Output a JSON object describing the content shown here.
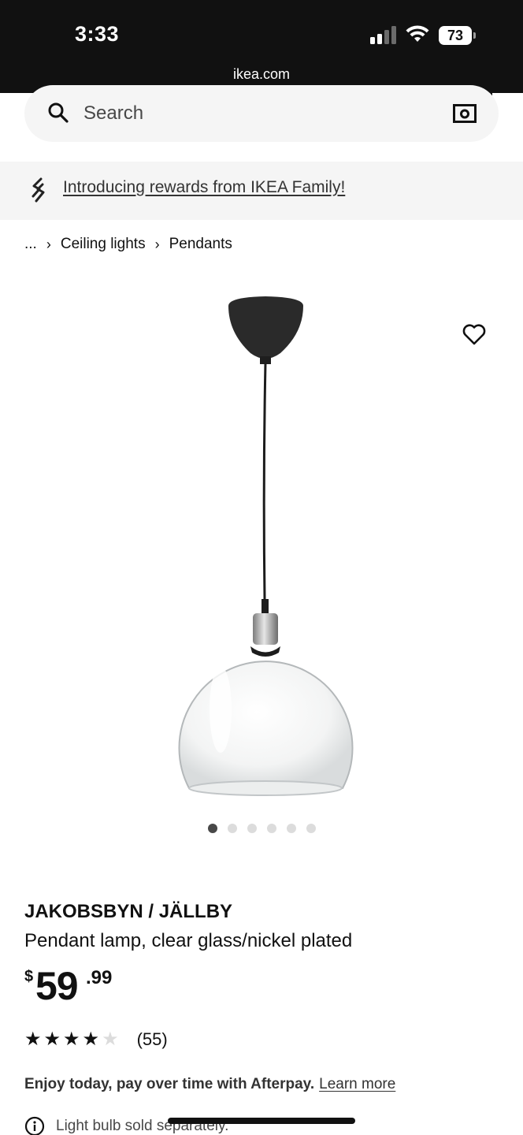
{
  "status_bar": {
    "time": "3:33",
    "battery": "73",
    "url": "ikea.com"
  },
  "search": {
    "placeholder": "Search"
  },
  "banner": {
    "text": "Introducing rewards from IKEA Family!"
  },
  "breadcrumb": {
    "ellipsis": "...",
    "items": [
      "Ceiling lights",
      "Pendants"
    ]
  },
  "carousel": {
    "total": 6,
    "active": 1
  },
  "product": {
    "name": "JAKOBSBYN / JÄLLBY",
    "description": "Pendant lamp, clear glass/nickel plated",
    "price_symbol": "$",
    "price_integer": "59",
    "price_decimal": ".99",
    "rating": 4,
    "rating_max": 5,
    "review_count": "(55)"
  },
  "afterpay": {
    "text": "Enjoy today, pay over time with Afterpay.",
    "link": "Learn more"
  },
  "note": {
    "text": "Light bulb sold separately."
  },
  "icons": {
    "search": "search-icon",
    "camera": "camera-icon",
    "banner": "ikea-family-icon",
    "favorite": "heart-icon",
    "info": "info-icon"
  },
  "colors": {
    "text": "#111111",
    "muted": "#484848",
    "surface": "#f5f5f5",
    "dot_inactive": "#dcdcdc"
  }
}
